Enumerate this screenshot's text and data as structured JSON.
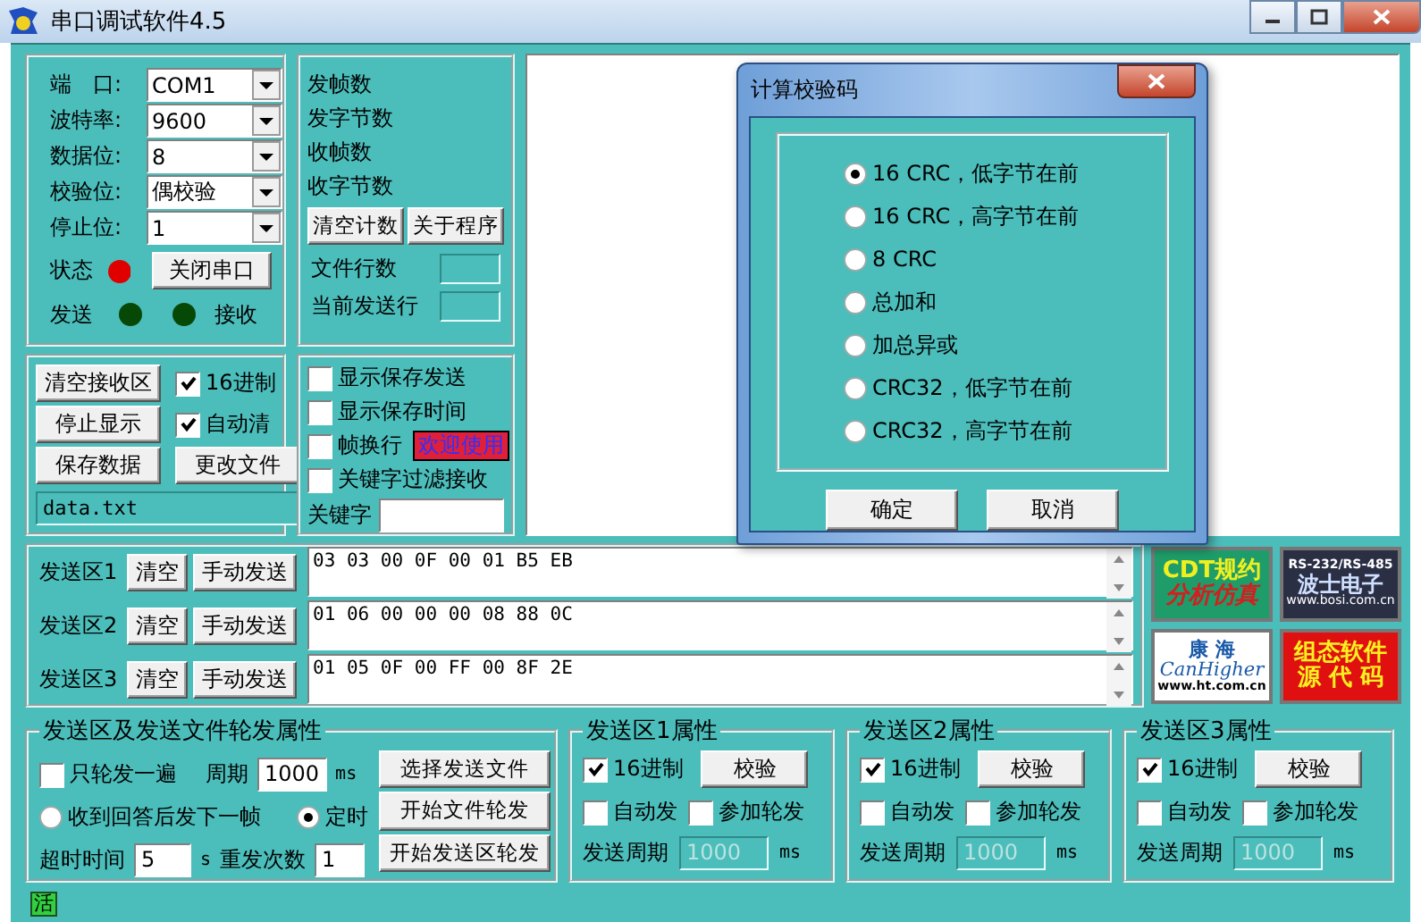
{
  "window": {
    "title": "串口调试软件4.5"
  },
  "port_settings": {
    "fields": [
      {
        "label": "端　口:",
        "value": "COM1"
      },
      {
        "label": "波特率:",
        "value": "9600"
      },
      {
        "label": "数据位:",
        "value": "8"
      },
      {
        "label": "校验位:",
        "value": "偶校验"
      },
      {
        "label": "停止位:",
        "value": "1"
      }
    ],
    "status_label": "状态",
    "status_on": true,
    "close_button": "关闭串口",
    "send_label": "发送",
    "send_active": false,
    "receive_label": "接收",
    "receive_active": false
  },
  "counters": {
    "labels": [
      "发帧数",
      "发字节数",
      "收帧数",
      "收字节数"
    ],
    "buttons": [
      "清空计数",
      "关于程序"
    ],
    "fields": [
      {
        "label": "文件行数"
      },
      {
        "label": "当前发送行"
      }
    ]
  },
  "receive_options": {
    "buttons": [
      "清空接收区",
      "停止显示",
      "保存数据",
      "更改文件"
    ],
    "checkboxes": [
      {
        "label": "16进制",
        "checked": true
      },
      {
        "label": "自动清",
        "checked": true
      }
    ],
    "file": "data.txt"
  },
  "display_options": {
    "checkboxes": [
      {
        "label": "显示保存发送",
        "checked": false
      },
      {
        "label": "显示保存时间",
        "checked": false
      },
      {
        "label": "帧换行",
        "checked": false
      },
      {
        "label": "关键字过滤接收",
        "checked": false
      }
    ],
    "banner": "欢迎使用",
    "keyword_label": "关键字"
  },
  "send_areas": [
    {
      "label": "发送区1",
      "clear_button": "清空",
      "send_button": "手动发送",
      "value": "03 03 00 0F 00 01 B5 EB"
    },
    {
      "label": "发送区2",
      "clear_button": "清空",
      "send_button": "手动发送",
      "value": "01 06 00 00 00 08 88 0C"
    },
    {
      "label": "发送区3",
      "clear_button": "清空",
      "send_button": "手动发送",
      "value": "01 05 0F 00 FF 00 8F 2E"
    }
  ],
  "ads": [
    {
      "lines": [
        "CDT规约",
        "分析仿真"
      ]
    },
    {
      "lines": [
        "RS-232/RS-485",
        "波士电子",
        "www.bosi.com.cn"
      ]
    },
    {
      "lines": [
        "康 海",
        "CanHigher",
        "www.ht.com.cn"
      ]
    },
    {
      "lines": [
        "组态软件",
        "源 代 码"
      ]
    }
  ],
  "polling": {
    "title": "发送区及发送文件轮发属性",
    "once": {
      "label": "只轮发一遍",
      "checked": false
    },
    "period_label": "周期",
    "period": "1000",
    "period_unit": "ms",
    "modes": [
      {
        "label": "收到回答后发下一帧",
        "selected": false
      },
      {
        "label": "定时",
        "selected": true
      }
    ],
    "timeout_label": "超时时间",
    "timeout": "5",
    "timeout_unit": "s",
    "retry_label": "重发次数",
    "retry": "1",
    "buttons": [
      "选择发送文件",
      "开始文件轮发",
      "开始发送区轮发"
    ]
  },
  "area_properties": [
    {
      "title": "发送区1属性",
      "hex": {
        "label": "16进制",
        "checked": true
      },
      "check_button": "校验",
      "auto_send": {
        "label": "自动发",
        "checked": false
      },
      "join_poll": {
        "label": "参加轮发",
        "checked": false
      },
      "period_label": "发送周期",
      "period": {
        "value": "1000",
        "disabled": true
      },
      "unit": "ms"
    },
    {
      "title": "发送区2属性",
      "hex": {
        "label": "16进制",
        "checked": true
      },
      "check_button": "校验",
      "auto_send": {
        "label": "自动发",
        "checked": false
      },
      "join_poll": {
        "label": "参加轮发",
        "checked": false
      },
      "period_label": "发送周期",
      "period": {
        "value": "1000",
        "disabled": true
      },
      "unit": "ms"
    },
    {
      "title": "发送区3属性",
      "hex": {
        "label": "16进制",
        "checked": true
      },
      "check_button": "校验",
      "auto_send": {
        "label": "自动发",
        "checked": false
      },
      "join_poll": {
        "label": "参加轮发",
        "checked": false
      },
      "period_label": "发送周期",
      "period": {
        "value": "1000",
        "disabled": true
      },
      "unit": "ms"
    }
  ],
  "status_bar": {
    "indicator": "活"
  },
  "dialog": {
    "title": "计算校验码",
    "options": [
      {
        "label": "16 CRC，低字节在前",
        "selected": true
      },
      {
        "label": "16 CRC，高字节在前",
        "selected": false
      },
      {
        "label": "8 CRC",
        "selected": false
      },
      {
        "label": "总加和",
        "selected": false
      },
      {
        "label": "加总异或",
        "selected": false
      },
      {
        "label": "CRC32，低字节在前",
        "selected": false
      },
      {
        "label": "CRC32，高字节在前",
        "selected": false
      }
    ],
    "buttons": [
      "确定",
      "取消"
    ]
  }
}
